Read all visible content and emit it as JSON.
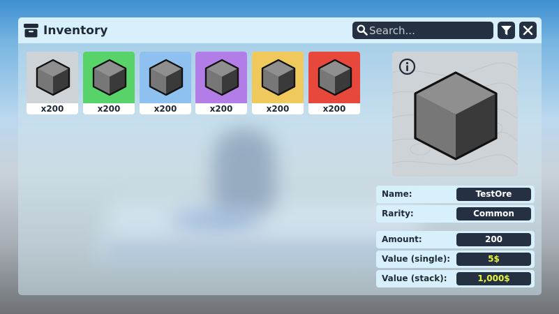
{
  "window": {
    "title": "Inventory",
    "title_icon": "archive-box-icon",
    "search": {
      "placeholder": "Search...",
      "value": "",
      "icon": "search-icon"
    },
    "buttons": {
      "filter_icon": "filter-icon",
      "close_icon": "close-icon"
    }
  },
  "items": [
    {
      "count": "x200",
      "rarity_color": "#cdd3d6"
    },
    {
      "count": "x200",
      "rarity_color": "#57d36a"
    },
    {
      "count": "x200",
      "rarity_color": "#8ec0f0"
    },
    {
      "count": "x200",
      "rarity_color": "#b37de8"
    },
    {
      "count": "x200",
      "rarity_color": "#f0c95c"
    },
    {
      "count": "x200",
      "rarity_color": "#e8483b"
    }
  ],
  "preview": {
    "info_icon": "info-icon",
    "item_icon": "cube-icon"
  },
  "details": {
    "name_label": "Name:",
    "name_value": "TestOre",
    "rarity_label": "Rarity:",
    "rarity_value": "Common",
    "amount_label": "Amount:",
    "amount_value": "200",
    "value_single_label": "Value (single):",
    "value_single_value": "5$",
    "value_stack_label": "Value (stack):",
    "value_stack_value": "1,000$"
  },
  "colors": {
    "panel_dark": "#253142",
    "panel_light": "#d8f0fb",
    "money_text": "#e6f53b"
  }
}
